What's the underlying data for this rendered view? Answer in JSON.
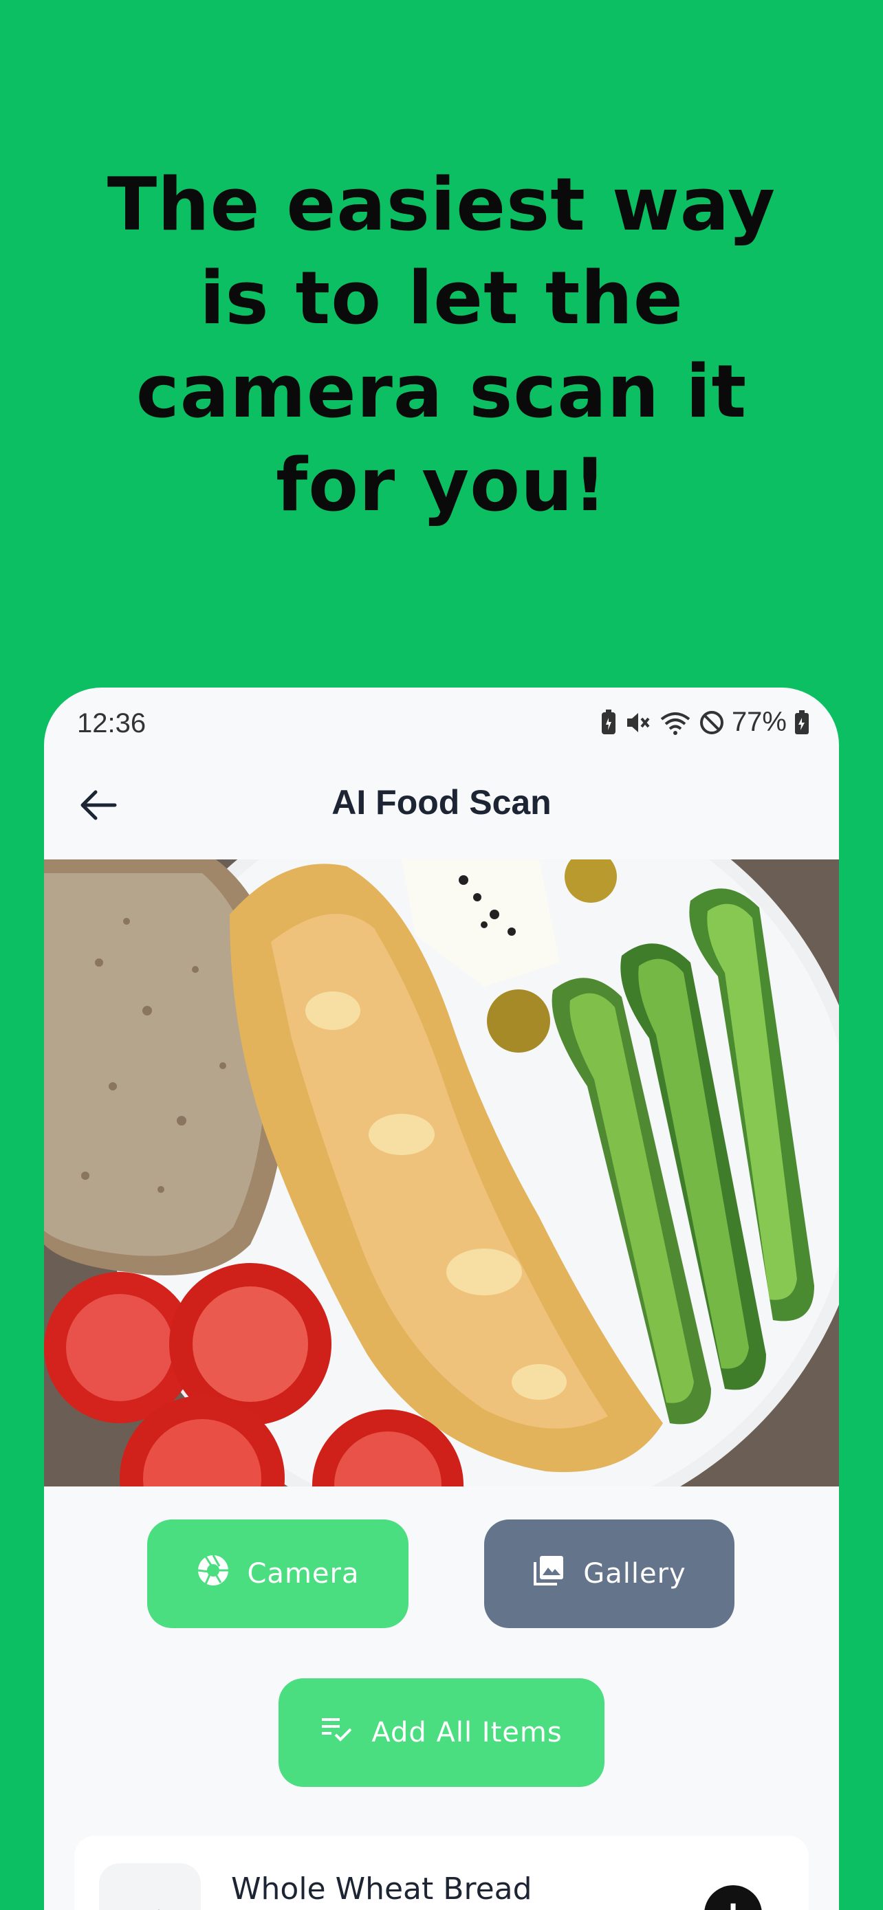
{
  "headline": {
    "lines": [
      "The easiest way",
      "is to let the",
      "camera scan it",
      "for you!"
    ]
  },
  "status": {
    "time": "12:36",
    "battery": "77%",
    "icons": [
      "battery-saver-icon",
      "mute-icon",
      "wifi-icon",
      "dnd-icon",
      "battery-charging-icon"
    ]
  },
  "appbar": {
    "title": "AI Food Scan",
    "back_icon": "arrow-left-icon"
  },
  "buttons": {
    "camera": "Camera",
    "gallery": "Gallery",
    "add_all": "Add All Items"
  },
  "items": [
    {
      "name": "Whole Wheat Bread",
      "icon": "sparkles-icon"
    }
  ],
  "colors": {
    "background": "#0dbf63",
    "primary_button": "#4ade80",
    "secondary_button": "#64748b"
  }
}
